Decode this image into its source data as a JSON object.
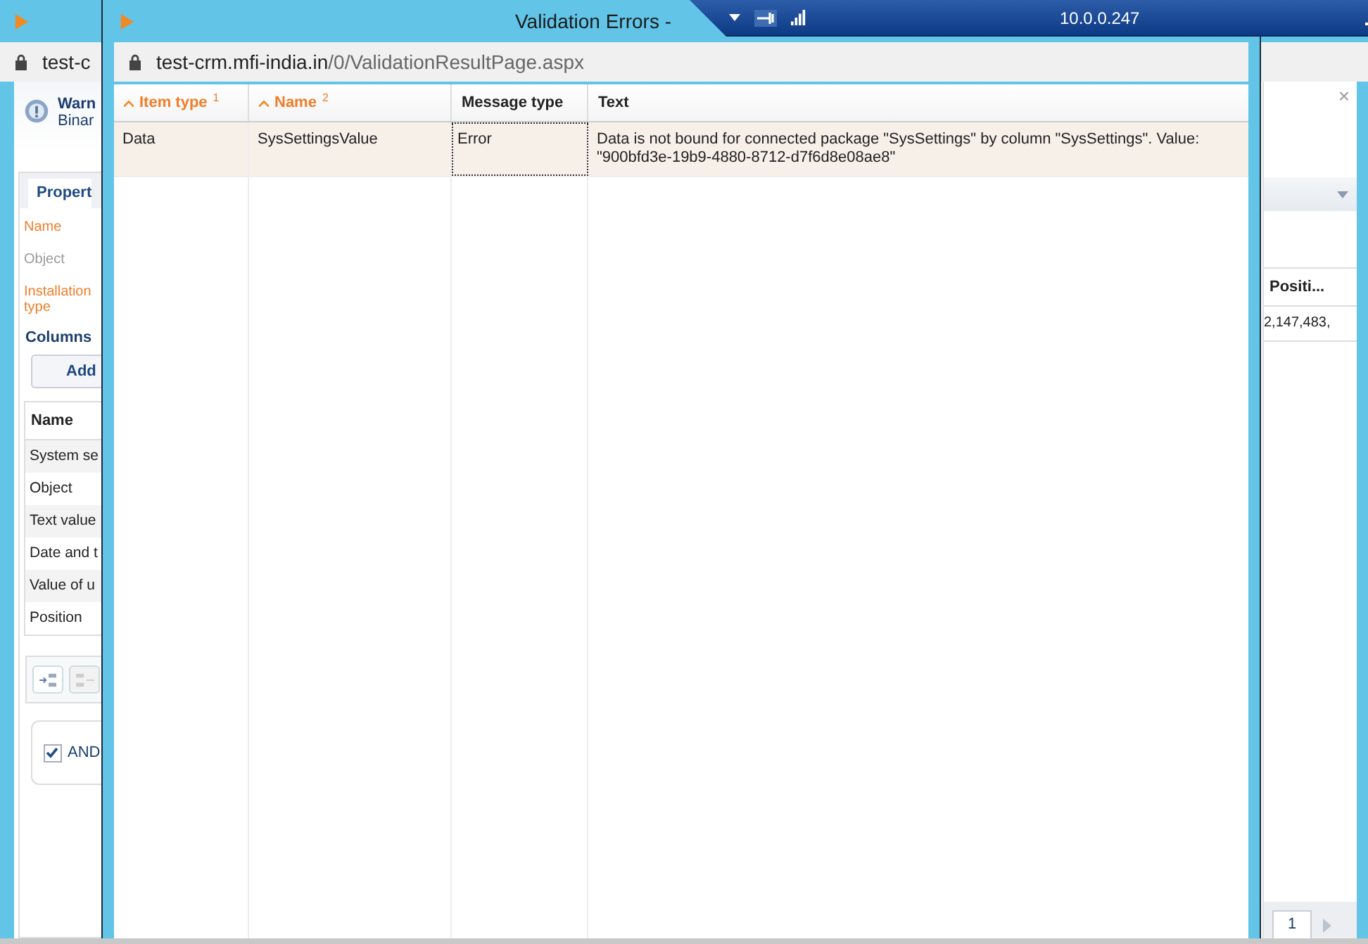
{
  "background_window": {
    "address": "test-c",
    "notice": {
      "title": "Warn",
      "subtitle": "Binar"
    },
    "tabs": [
      {
        "label": "Propert",
        "selected": true
      }
    ],
    "fields": [
      {
        "label": "Name",
        "kind": "required"
      },
      {
        "label": "Object",
        "kind": "readonly"
      },
      {
        "label": "Installation type",
        "kind": "required"
      }
    ],
    "columns_section": {
      "title": "Columns",
      "add_button": "Add",
      "grid_header": "Name",
      "rows": [
        "System se",
        "Object",
        "Text value",
        "Date and t",
        "Value of u",
        "Position"
      ]
    },
    "filter": {
      "label": "AND",
      "checked": true
    },
    "right_grid": {
      "header": "Positi...",
      "cell": "2,147,483,"
    },
    "pager": {
      "page": "1"
    },
    "close_glyph": "×"
  },
  "popup": {
    "title": "Validation Errors -",
    "url": {
      "host": "test-crm.mfi-india.in",
      "path": "/0/ValidationResultPage.aspx"
    },
    "table": {
      "columns": [
        {
          "label": "Item type",
          "sorted": true,
          "sort_index": "1"
        },
        {
          "label": "Name",
          "sorted": true,
          "sort_index": "2"
        },
        {
          "label": "Message type",
          "sorted": false
        },
        {
          "label": "Text",
          "sorted": false
        }
      ],
      "rows": [
        {
          "selected": true,
          "cells": [
            {
              "text": "Data",
              "focused": false
            },
            {
              "text": "SysSettingsValue",
              "focused": false
            },
            {
              "text": "Error",
              "focused": true
            },
            {
              "text": "Data is not bound for connected package \"SysSettings\" by column \"SysSettings\". Value: \"900bfd3e-19b9-4880-8712-d7f6d8e08ae8\"",
              "focused": false
            }
          ]
        }
      ]
    }
  },
  "remote_bar": {
    "host": "10.0.0.247"
  }
}
